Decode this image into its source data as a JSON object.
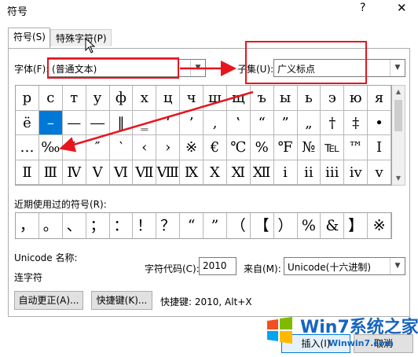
{
  "window": {
    "title": "符号",
    "help_glyph": "?",
    "close_glyph": "✕"
  },
  "tabs": [
    {
      "label": "符号(S)",
      "active": true
    },
    {
      "label": "特殊字符(P)",
      "active": false
    }
  ],
  "font": {
    "label": "字体(F):",
    "value": "(普通文本)"
  },
  "subset": {
    "label": "子集(U):",
    "value": "广义标点"
  },
  "symbols": [
    "р",
    "с",
    "т",
    "у",
    "ф",
    "х",
    "ц",
    "ч",
    "ш",
    "щ",
    "ъ",
    "ы",
    "ь",
    "э",
    "ю",
    "я",
    "ё",
    "–",
    "—",
    "―",
    "‖",
    "‗",
    "‘",
    "’",
    "‚",
    "‛",
    "“",
    "”",
    "„",
    "†",
    "‡",
    "•",
    "…",
    "‰",
    "′",
    "″",
    "‵",
    "‹",
    "›",
    "※",
    "€",
    "℃",
    "%",
    "℉",
    "№",
    "℡",
    "™",
    "Ⅰ",
    "Ⅱ",
    "Ⅲ",
    "Ⅳ",
    "Ⅴ",
    "Ⅵ",
    "Ⅶ",
    "Ⅷ",
    "Ⅸ",
    "Ⅹ",
    "Ⅺ",
    "Ⅻ",
    "ⅰ",
    "ⅱ",
    "ⅲ",
    "ⅳ",
    "ⅴ"
  ],
  "selected_index": 17,
  "recent": {
    "label": "近期使用过的符号(R):",
    "items": [
      "，",
      "。",
      "、",
      "；",
      "：",
      "！",
      "？",
      "“",
      "”",
      "（",
      "【",
      "）",
      "%",
      "&",
      "】",
      "※"
    ]
  },
  "unicode": {
    "name_label": "Unicode 名称:",
    "name_value": "连字符"
  },
  "charcode": {
    "label": "字符代码(C):",
    "value": "2010"
  },
  "from": {
    "label": "来自(M):",
    "value": "Unicode(十六进制)"
  },
  "buttons": {
    "autocorrect": "自动更正(A)...",
    "shortcut": "快捷键(K)...",
    "shortcut_text": "快捷键: 2010, Alt+X",
    "insert": "插入(I)",
    "cancel": "取消"
  },
  "watermark": {
    "text": "Win7系统之家",
    "url": "Winwin7.com"
  },
  "colors": {
    "selection": "#0078d7",
    "annotation": "#e8141e",
    "watermark": "#1565c0"
  }
}
